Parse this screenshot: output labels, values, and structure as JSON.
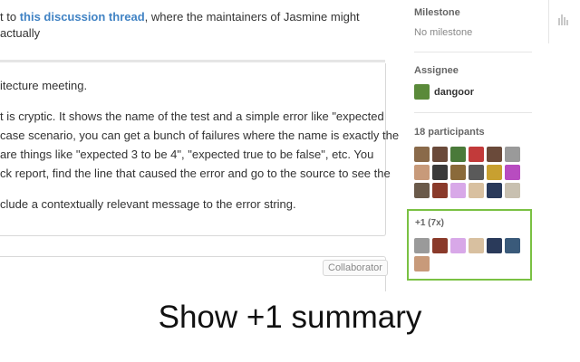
{
  "comment": {
    "top_line_1_pre": "t to ",
    "top_line_1_link": "this discussion thread",
    "top_line_1_post": ", where the maintainers of Jasmine might actually",
    "body_lines": [
      "itecture meeting.",
      "",
      "t is cryptic. It shows the name of the test and a simple error like \"expected",
      "case scenario, you can get a bunch of failures where the name is exactly the",
      " are things like \"expected 3 to be 4\", \"expected true to be false\", etc. You",
      "ck report, find the line that caused the error and go to the source to see the",
      "",
      "clude a contextually relevant message to the error string."
    ],
    "collaborator_badge": "Collaborator"
  },
  "sidebar": {
    "milestone": {
      "heading": "Milestone",
      "value": "No milestone"
    },
    "assignee": {
      "heading": "Assignee",
      "name": "dangoor"
    },
    "participants": {
      "heading": "18 participants",
      "avatar_colors": [
        "#8a6a4a",
        "#6a4a3a",
        "#4a7a3a",
        "#c23a3a",
        "#6a4a3a",
        "#9a9a9a",
        "#c89a7a",
        "#3a3a3a",
        "#8a6a3a",
        "#5a5a5a",
        "#c8a030",
        "#b84cc0",
        "#6a5a4a",
        "#8a3a2a",
        "#d8a8e8",
        "#d8c0a0",
        "#2a3a5a",
        "#c8c0b0"
      ]
    },
    "plus_one": {
      "title": "+1 (7x)",
      "avatar_colors": [
        "#9a9a9a",
        "#8a3a2a",
        "#d8a8e8",
        "#d8c0a0",
        "#2a3a5a",
        "#3a5a7a",
        "#c89a7a"
      ]
    }
  },
  "caption": {
    "text": "Show +1 summary"
  }
}
